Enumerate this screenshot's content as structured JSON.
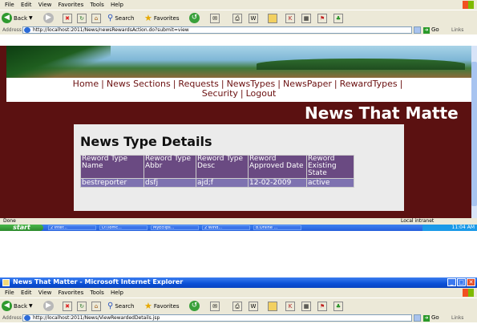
{
  "screen1": {
    "menu": [
      "File",
      "Edit",
      "View",
      "Favorites",
      "Tools",
      "Help"
    ],
    "toolbar": {
      "back": "Back",
      "search": "Search",
      "favorites": "Favorites"
    },
    "address": {
      "label": "Address",
      "url": "http://localhost:2011/News/newsRewardsAction.do?submit=view",
      "go": "Go",
      "links": "Links"
    },
    "nav": {
      "home": "Home",
      "news_sections": "News Sections",
      "requests": "Requests",
      "news_types": "NewsTypes",
      "news_paper": "NewsPaper",
      "reward_types": "RewardTypes",
      "security": "Security",
      "logout": "Logout"
    },
    "headline": "News That Matte",
    "panel_title": "News Type Details",
    "table": {
      "headers": [
        "Reword Type Name",
        "Reword Type Abbr",
        "Reword Type Desc",
        "Reword Approved Date",
        "Reword Existing State"
      ],
      "rows": [
        [
          "bestreporter",
          "dsfj",
          "ajd;f",
          "12-02-2009",
          "active"
        ]
      ]
    },
    "status": {
      "done": "Done",
      "zone": "Local intranet"
    },
    "taskbar": {
      "start": "start",
      "tasks": [
        "2 Inter...",
        "D:\\Tomc...",
        "MyEclips...",
        "2 Wind...",
        "8.Online ..."
      ],
      "clock": "11:04 AM"
    }
  },
  "screen2": {
    "window_title": "News That Matter - Microsoft Internet Explorer",
    "menu": [
      "File",
      "Edit",
      "View",
      "Favorites",
      "Tools",
      "Help"
    ],
    "toolbar": {
      "back": "Back",
      "search": "Search",
      "favorites": "Favorites"
    },
    "address": {
      "label": "Address",
      "url": "http://localhost:2011/News/ViewRewardedDetails.jsp",
      "go": "Go",
      "links": "Links"
    }
  }
}
